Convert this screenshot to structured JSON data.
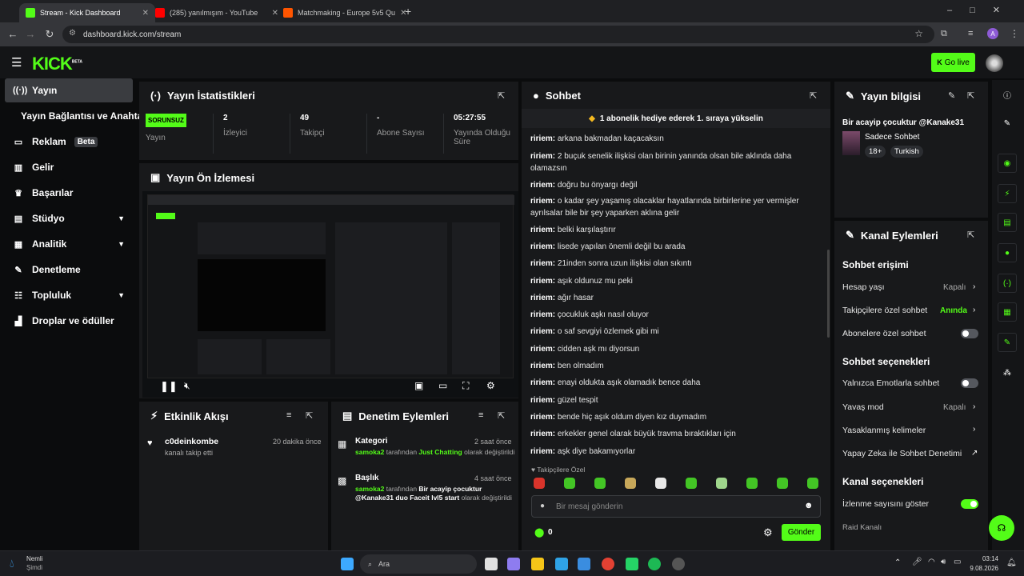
{
  "browser": {
    "tabs": [
      {
        "title": "Stream - Kick Dashboard",
        "active": true
      },
      {
        "title": "(285) yanılmışım - YouTube",
        "active": false
      },
      {
        "title": "Matchmaking - Europe 5v5 Qu",
        "active": false
      }
    ],
    "url": "dashboard.kick.com/stream",
    "profile_initial": "A"
  },
  "topbar": {
    "logo": "KICK",
    "logo_sup": "BETA",
    "go_live": "Go live"
  },
  "sidebar": {
    "items": [
      {
        "label": "Yayın",
        "icon": "broadcast-icon"
      },
      {
        "label": "Yayın Bağlantısı ve Anahtarı",
        "icon": ""
      },
      {
        "label": "Reklam",
        "icon": "ad-icon",
        "badge": "Beta"
      },
      {
        "label": "Gelir",
        "icon": "chart-icon"
      },
      {
        "label": "Başarılar",
        "icon": "trophy-icon"
      },
      {
        "label": "Stüdyo",
        "icon": "studio-icon"
      },
      {
        "label": "Analitik",
        "icon": "analytics-icon"
      },
      {
        "label": "Denetleme",
        "icon": "wrench-icon"
      },
      {
        "label": "Topluluk",
        "icon": "community-icon"
      },
      {
        "label": "Droplar ve ödüller",
        "icon": "gift-icon"
      }
    ]
  },
  "stats": {
    "title": "Yayın İstatistikleri",
    "items": [
      {
        "value": "SORUNSUZ",
        "label": "Yayın"
      },
      {
        "value": "2",
        "label": "İzleyici"
      },
      {
        "value": "49",
        "label": "Takipçi"
      },
      {
        "value": "-",
        "label": "Abone Sayısı"
      },
      {
        "value": "05:27:55",
        "label": "Yayında Olduğu Süre"
      }
    ]
  },
  "preview": {
    "title": "Yayın Ön İzlemesi"
  },
  "activity": {
    "title": "Etkinlik Akışı",
    "items": [
      {
        "user": "c0deinkombe",
        "text": "kanalı takip etti",
        "time": "20 dakika önce"
      }
    ]
  },
  "moderation": {
    "title": "Denetim Eylemleri",
    "items": [
      {
        "title": "Kategori",
        "time": "2 saat önce",
        "user": "samoka2",
        "mid": "tarafından",
        "value": "Just Chatting",
        "end": "olarak değiştirildi"
      },
      {
        "title": "Başlık",
        "time": "4 saat önce",
        "user": "samoka2",
        "mid": "tarafından",
        "value": "Bir acayip çocuktur @Kanake31 duo Faceit lvl5 start",
        "end": "olarak değiştirildi"
      }
    ]
  },
  "chat": {
    "title": "Sohbet",
    "pinned": "1 abonelik hediye ederek 1. sıraya yükselin",
    "messages": [
      {
        "user": "ririem:",
        "text": "arkana bakmadan kaçacaksın"
      },
      {
        "user": "ririem:",
        "text": "2 buçuk senelik ilişkisi olan birinin yanında olsan bile aklında daha olamazsın"
      },
      {
        "user": "ririem:",
        "text": "doğru bu önyargı değil"
      },
      {
        "user": "ririem:",
        "text": "o kadar şey yaşamış olacaklar hayatlarında birbirlerine yer vermişler ayrılsalar bile bir şey yaparken aklına gelir"
      },
      {
        "user": "ririem:",
        "text": "belki karşılaştırır"
      },
      {
        "user": "ririem:",
        "text": "lisede yapılan önemli değil bu arada"
      },
      {
        "user": "ririem:",
        "text": "21inden sonra uzun ilişkisi olan sıkıntı"
      },
      {
        "user": "ririem:",
        "text": "aşık oldunuz mu peki"
      },
      {
        "user": "ririem:",
        "text": "ağır hasar"
      },
      {
        "user": "ririem:",
        "text": "çocukluk aşkı nasıl oluyor"
      },
      {
        "user": "ririem:",
        "text": "o saf sevgiyi özlemek gibi mi"
      },
      {
        "user": "ririem:",
        "text": "cidden aşk mı diyorsun"
      },
      {
        "user": "ririem:",
        "text": "ben olmadım"
      },
      {
        "user": "ririem:",
        "text": "enayi oldukta aşık olamadık bence daha"
      },
      {
        "user": "ririem:",
        "text": "güzel tespit"
      },
      {
        "user": "ririem:",
        "text": "bende hiç aşık oldum diyen kız duymadım"
      },
      {
        "user": "ririem:",
        "text": "erkekler genel olarak büyük travma bıraktıkları için"
      },
      {
        "user": "ririem:",
        "text": "aşk diye bakamıyorlar"
      }
    ],
    "emote_label": "Takipçilere Özel",
    "input_placeholder": "Bir mesaj gönderin",
    "points": "0",
    "send": "Gönder"
  },
  "stream_info": {
    "title": "Yayın bilgisi",
    "stream_title": "Bir acayip çocuktur @Kanake31",
    "category": "Sadece Sohbet",
    "tags": [
      "18+",
      "Turkish"
    ]
  },
  "channel_actions": {
    "title": "Kanal Eylemleri",
    "section_chat_access": "Sohbet erişimi",
    "account_age": {
      "label": "Hesap yaşı",
      "value": "Kapalı"
    },
    "followers_only": {
      "label": "Takipçilere özel sohbet",
      "value": "Anında"
    },
    "subscribers_only": {
      "label": "Abonelere özel sohbet"
    },
    "section_chat_options": "Sohbet seçenekleri",
    "emotes_only": {
      "label": "Yalnızca Emotlarla sohbet"
    },
    "slow_mode": {
      "label": "Yavaş mod",
      "value": "Kapalı"
    },
    "banned_words": {
      "label": "Yasaklanmış kelimeler"
    },
    "ai_moderation": {
      "label": "Yapay Zeka ile Sohbet Denetimi"
    },
    "section_channel_options": "Kanal seçenekleri",
    "show_viewer_count": {
      "label": "İzlenme sayısını göster"
    },
    "raid": {
      "label": "Raid Kanalı"
    }
  },
  "taskbar": {
    "weather_title": "Nemli",
    "weather_sub": "Şimdi",
    "search": "Ara",
    "time": "03:14",
    "date": "9.08.2026"
  },
  "colors": {
    "accent": "#53fc18",
    "panel": "#18191b",
    "bg": "#0b0c0d"
  }
}
